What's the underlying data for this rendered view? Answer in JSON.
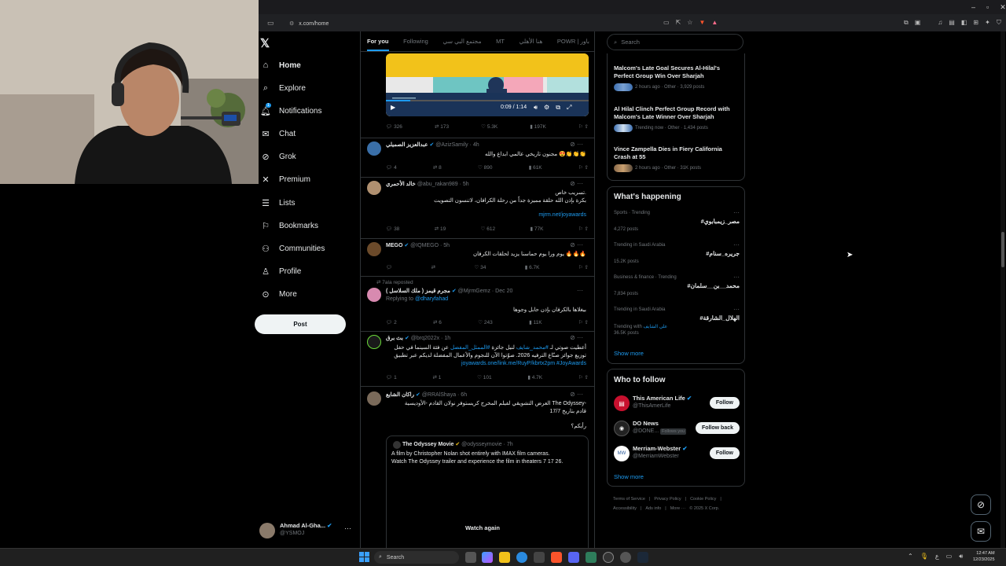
{
  "browser": {
    "url": "x.com/home"
  },
  "sidebar": {
    "items": [
      {
        "label": "Home",
        "icon": "home-icon"
      },
      {
        "label": "Explore",
        "icon": "search-icon"
      },
      {
        "label": "Notifications",
        "icon": "bell-icon",
        "badge": "1"
      },
      {
        "label": "Chat",
        "icon": "mail-icon"
      },
      {
        "label": "Grok",
        "icon": "grok-icon"
      },
      {
        "label": "Premium",
        "icon": "x-logo-icon"
      },
      {
        "label": "Lists",
        "icon": "list-icon"
      },
      {
        "label": "Bookmarks",
        "icon": "bookmark-icon"
      },
      {
        "label": "Communities",
        "icon": "people-icon"
      },
      {
        "label": "Profile",
        "icon": "person-icon"
      },
      {
        "label": "More",
        "icon": "more-circle-icon"
      }
    ],
    "post_label": "Post",
    "account": {
      "name": "Ahmad Al-Gha...",
      "handle": "@YSMOJ"
    }
  },
  "feed": {
    "tabs": [
      "For you",
      "Following",
      "مجتمع البي سي",
      "MT",
      "هنا الأهلي",
      "POWR | باور"
    ],
    "video": {
      "time": "0:09 / 1:14"
    },
    "video_stats": {
      "replies": "326",
      "reposts": "173",
      "likes": "5.3K",
      "views": "197K"
    },
    "tweets": [
      {
        "name": "عبدالعزيز الصميلي",
        "handle": "@AzizSamily · 4h",
        "text": "مجنون تاريخي عالمي ابداع والله 😍👏👏👏",
        "replies": "4",
        "reposts": "8",
        "likes": "890",
        "views": "61K"
      },
      {
        "name": "خالد الأحمري",
        "handle": "@abu_rakan989 · 5h",
        "text1": "تسريب خاص.",
        "text2": "بكرة بإذن الله حلقة مميزة جداً من رحلة الكرافان، لاتنسون التصويت",
        "link": "mjrm.net/joyawards",
        "replies": "38",
        "reposts": "19",
        "likes": "612",
        "views": "77K"
      },
      {
        "name": "MEGO",
        "handle": "@IQMEGO · 5h",
        "text": "يوم ورا يوم حماسنا يزيد لحلقات الكرفان 🔥🔥🔥",
        "replies": "",
        "reposts": "",
        "likes": "34",
        "views": "6.7K"
      },
      {
        "reposted": "7ala reposted",
        "name": "مجرم قيمز ( ملك السلاسل )",
        "handle": "@MjrmGemz · Dec 20",
        "replying": "Replying to",
        "replying_handle": "@dharyfahad",
        "text": "بيغلاها بالكرفان بإذن حابل وجوها",
        "replies": "2",
        "reposts": "6",
        "likes": "243",
        "views": "11K"
      },
      {
        "name": "بث برق",
        "handle": "@brq2022x · 1h",
        "line1a": "أعطيت صوتي لـ",
        "line1b": "#محمد_شايف",
        "line1c": "لنيل جائزة",
        "line1d": "#الممثل_المفضل",
        "line1e": "عن فئة السينما في حفل",
        "line2": "توزيع جوائز صنّاع الترفيه 2026. صوّتوا الآن للنجوم والأعمال المفضلة لديكم عبر تطبيق",
        "line3": "joyawards.one/link.me/RuyP/kbrtx2pm #JoyAwards",
        "replies": "1",
        "reposts": "1",
        "likes": "101",
        "views": "4.7K"
      },
      {
        "name": "راكان الشايع",
        "handle": "@RRAlShaya · 6h",
        "line1": "العرض التشويقي لفيلم المخرج كريستوفر نولان القادم -الأوديسية The Odyssey-",
        "line2": "قادم بتاريخ 17/7",
        "line3": "رأيكم؟"
      }
    ],
    "quote": {
      "name": "The Odyssey Movie",
      "handle": "@odysseymovie · 7h",
      "text1": "A film by Christopher Nolan shot entirely with IMAX film cameras.",
      "text2": "Watch The Odyssey trailer and experience the film in theaters 7 17 26.",
      "watch_again": "Watch again"
    }
  },
  "right": {
    "search_placeholder": "Search",
    "news": [
      {
        "title": "Malcom's Late Goal Secures Al-Hilal's Perfect Group Win Over Sharjah",
        "meta": "2 hours ago · Other · 3,929 posts"
      },
      {
        "title": "Al Hilal Clinch Perfect Group Record with Malcom's Late Winner Over Sharjah",
        "meta": "Trending now · Other · 1,434 posts"
      },
      {
        "title": "Vince Zampella Dies in Fiery California Crash at 55",
        "meta": "2 hours ago · Other · 31K posts"
      }
    ],
    "whats_happening_title": "What's happening",
    "trends": [
      {
        "meta": "Sports · Trending",
        "title": "#مصر_زيمبابوي",
        "posts": "4,272 posts"
      },
      {
        "meta": "Trending in Saudi Arabia",
        "title": "#جريره_سنام",
        "posts": "15.2K posts"
      },
      {
        "meta": "Business & finance · Trending",
        "title": "#محمد__بن__سلمان",
        "posts": "7,834 posts"
      },
      {
        "meta": "Trending in Saudi Arabia",
        "title": "#الهلال_الشارقة",
        "trending_with": "Trending with",
        "trending_with_link": "علي الشايف",
        "posts": "36.5K posts"
      }
    ],
    "show_more": "Show more",
    "who_to_follow_title": "Who to follow",
    "follow": [
      {
        "name": "This American Life",
        "handle": "@ThisAmerLife",
        "button": "Follow",
        "color": "#c8102e"
      },
      {
        "name": "DO News",
        "handle": "@DONE...",
        "follows_you": "Follows you",
        "button": "Follow back",
        "color": "#222222"
      },
      {
        "name": "Merriam-Webster",
        "handle": "@MerriamWebster",
        "button": "Follow",
        "color": "#ffffff"
      }
    ],
    "footer_line1": [
      "Terms of Service",
      "|",
      "Privacy Policy",
      "|",
      "Cookie Policy",
      "|"
    ],
    "footer_line2": [
      "Accessibility",
      "|",
      "Ads info",
      "|",
      "More ···",
      "© 2025 X Corp."
    ]
  },
  "taskbar": {
    "search_label": "Search",
    "time": "12:47 AM",
    "date": "12/23/2025",
    "lang": "ع"
  },
  "colors": {
    "accent": "#1d9bf0",
    "bg": "#000000",
    "border": "#2f3336",
    "muted": "#71767b"
  }
}
